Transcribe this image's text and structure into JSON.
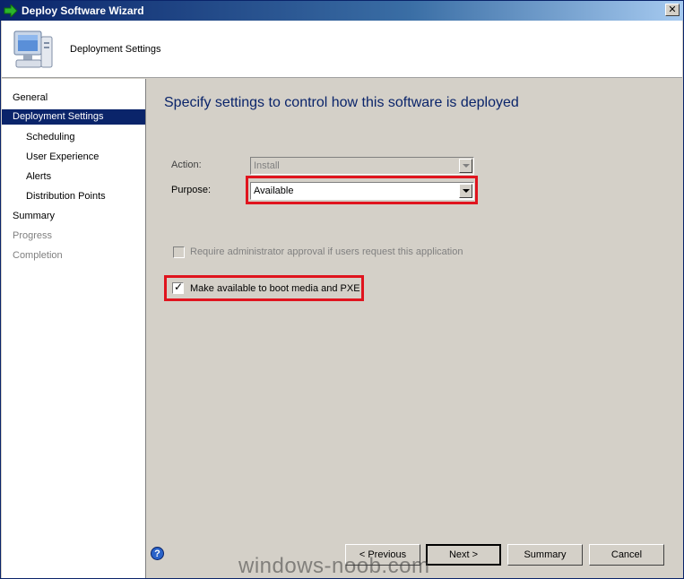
{
  "window": {
    "title": "Deploy Software Wizard",
    "close_glyph": "✕"
  },
  "header": {
    "title": "Deployment Settings",
    "icon": "computer-icon"
  },
  "sidebar": {
    "items": [
      {
        "label": "General",
        "state": "normal"
      },
      {
        "label": "Deployment Settings",
        "state": "selected"
      },
      {
        "label": "Scheduling",
        "state": "normal"
      },
      {
        "label": "User Experience",
        "state": "normal"
      },
      {
        "label": "Alerts",
        "state": "normal"
      },
      {
        "label": "Distribution Points",
        "state": "normal"
      },
      {
        "label": "Summary",
        "state": "normal"
      },
      {
        "label": "Progress",
        "state": "disabled"
      },
      {
        "label": "Completion",
        "state": "disabled"
      }
    ]
  },
  "main": {
    "heading": "Specify settings to control how this software is deployed",
    "action": {
      "label": "Action:",
      "value": "Install",
      "enabled": false
    },
    "purpose": {
      "label": "Purpose:",
      "value": "Available",
      "enabled": true
    },
    "require_approval": {
      "label": "Require administrator approval if users request this application",
      "checked": false,
      "enabled": false
    },
    "boot_media": {
      "label": "Make available to boot media and PXE",
      "checked": true,
      "enabled": true
    }
  },
  "footer": {
    "help_glyph": "?",
    "buttons": {
      "previous": "< Previous",
      "next": "Next >",
      "summary": "Summary",
      "cancel": "Cancel"
    }
  },
  "watermark": "windows-noob.com",
  "colors": {
    "highlight": "#e0141e",
    "selection": "#0a246a",
    "heading": "#0a246a"
  }
}
